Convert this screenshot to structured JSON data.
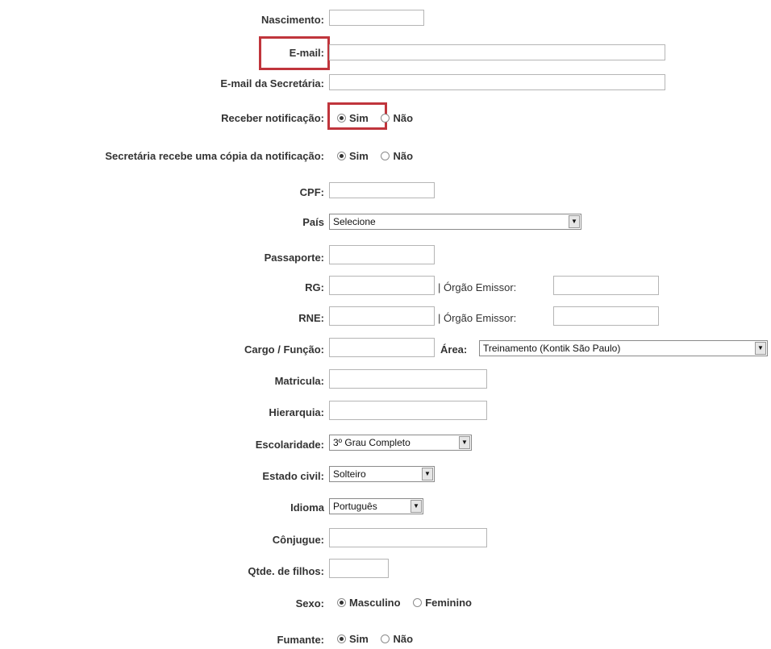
{
  "form": {
    "nascimento": {
      "label": "Nascimento:",
      "value": ""
    },
    "email": {
      "label": "E-mail:",
      "value": ""
    },
    "email_secretaria": {
      "label": "E-mail da Secretária:",
      "value": ""
    },
    "receber_notificacao": {
      "label": "Receber notificação:",
      "options": [
        "Sim",
        "Não"
      ],
      "selected": "Sim"
    },
    "secretaria_copia": {
      "label": "Secretária recebe uma cópia da notificação:",
      "options": [
        "Sim",
        "Não"
      ],
      "selected": "Sim"
    },
    "cpf": {
      "label": "CPF:",
      "value": ""
    },
    "pais": {
      "label": "País",
      "selected": "Selecione"
    },
    "passaporte": {
      "label": "Passaporte:",
      "value": ""
    },
    "rg": {
      "label": "RG:",
      "value": "",
      "orgao_label": "| Órgão Emissor:",
      "orgao_value": ""
    },
    "rne": {
      "label": "RNE:",
      "value": "",
      "orgao_label": "| Órgão Emissor:",
      "orgao_value": ""
    },
    "cargo": {
      "label": "Cargo / Função:",
      "value": "",
      "area_label": "Área:",
      "area_selected": "Treinamento (Kontik São Paulo)"
    },
    "matricula": {
      "label": "Matricula:",
      "value": ""
    },
    "hierarquia": {
      "label": "Hierarquia:",
      "value": ""
    },
    "escolaridade": {
      "label": "Escolaridade:",
      "selected": "3º Grau Completo"
    },
    "estado_civil": {
      "label": "Estado civil:",
      "selected": "Solteiro"
    },
    "idioma": {
      "label": "Idioma",
      "selected": "Português"
    },
    "conjugue": {
      "label": "Cônjugue:",
      "value": ""
    },
    "filhos": {
      "label": "Qtde. de filhos:",
      "value": ""
    },
    "sexo": {
      "label": "Sexo:",
      "options": [
        "Masculino",
        "Feminino"
      ],
      "selected": "Masculino"
    },
    "fumante": {
      "label": "Fumante:",
      "options": [
        "Sim",
        "Não"
      ],
      "selected": "Sim"
    }
  },
  "icons": {
    "dropdown_arrow": "chevron-down-icon",
    "radio": "radio-button-icon"
  },
  "colors": {
    "highlight": "#c0353c",
    "label_text": "#333333"
  }
}
